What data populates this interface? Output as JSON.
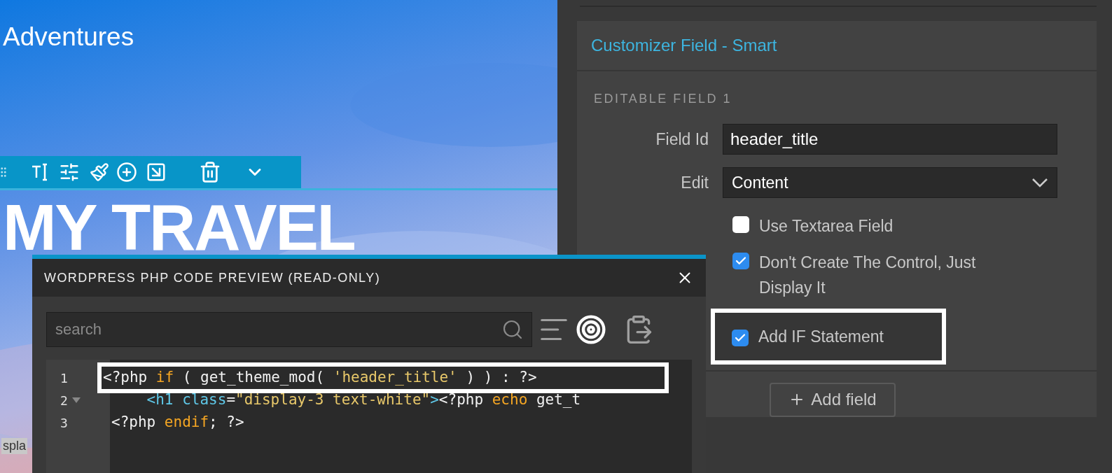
{
  "preview": {
    "site_title": "Adventures",
    "hero_title": "MY TRAVEL",
    "tag_fragment": "spla"
  },
  "code_preview": {
    "title": "WORDPRESS PHP CODE PREVIEW (READ-ONLY)",
    "search": {
      "placeholder": "search"
    },
    "lines": [
      {
        "number": "1",
        "foldable": false,
        "highlighted": true,
        "tokens": [
          {
            "kind": "plain",
            "text": "<?php "
          },
          {
            "kind": "keyword",
            "text": "if"
          },
          {
            "kind": "plain",
            "text": " ( get_theme_mod( "
          },
          {
            "kind": "string",
            "text": "'header_title'"
          },
          {
            "kind": "plain",
            "text": " ) ) : ?>"
          }
        ]
      },
      {
        "number": "2",
        "foldable": true,
        "highlighted": false,
        "tokens": [
          {
            "kind": "tag",
            "text": "    <h1 class"
          },
          {
            "kind": "plain",
            "text": "="
          },
          {
            "kind": "string",
            "text": "\"display-3 text-white\""
          },
          {
            "kind": "tag",
            "text": ">"
          },
          {
            "kind": "plain",
            "text": "<?php "
          },
          {
            "kind": "keyword",
            "text": "echo"
          },
          {
            "kind": "plain",
            "text": " get_t"
          }
        ]
      },
      {
        "number": "3",
        "foldable": false,
        "highlighted": false,
        "tokens": [
          {
            "kind": "plain",
            "text": "<?php "
          },
          {
            "kind": "keyword",
            "text": "endif"
          },
          {
            "kind": "plain",
            "text": "; ?>"
          }
        ]
      }
    ]
  },
  "panel": {
    "title": "Customizer Field - Smart",
    "section": "EDITABLE FIELD 1",
    "fields": [
      {
        "kind": "text",
        "label": "Field Id",
        "value": "header_title"
      },
      {
        "kind": "select",
        "label": "Edit",
        "value": "Content"
      }
    ],
    "options": [
      {
        "label": "Use Textarea Field",
        "checked": false,
        "highlighted": false
      },
      {
        "label": "Don't Create The Control, Just Display It",
        "checked": true,
        "highlighted": false
      },
      {
        "label": "Add IF Statement",
        "checked": true,
        "highlighted": true
      }
    ],
    "add_button": "Add field"
  }
}
